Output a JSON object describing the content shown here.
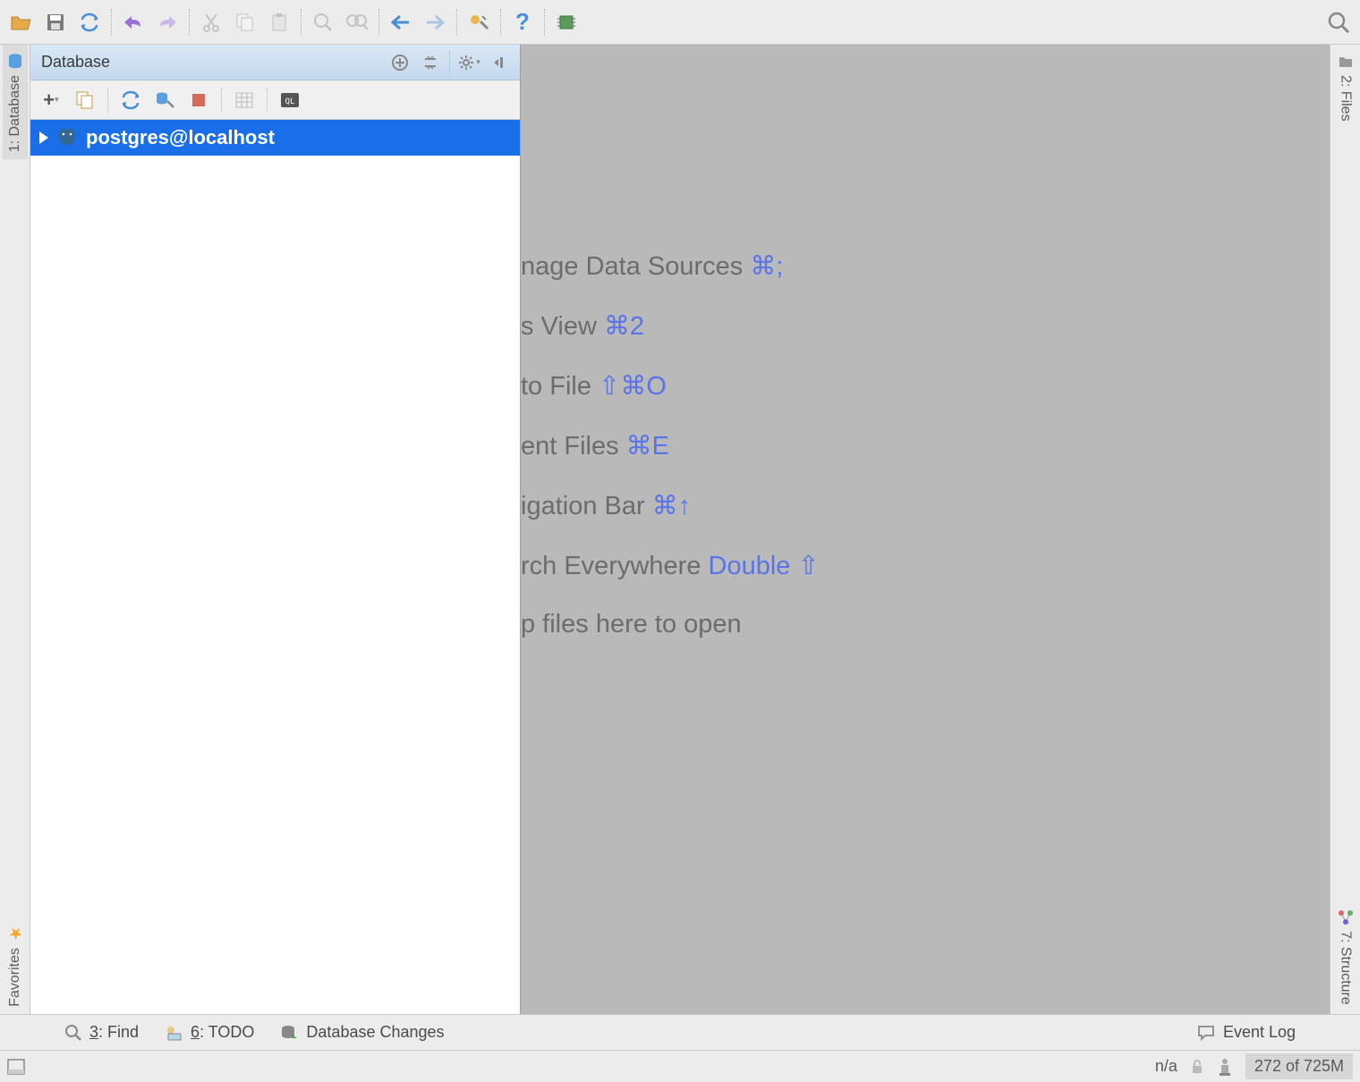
{
  "toolbar": {
    "icons": [
      "folder-open",
      "save",
      "sync",
      "sep",
      "undo",
      "redo",
      "sep",
      "cut",
      "copy",
      "paste",
      "sep",
      "zoom-out",
      "zoom-reset",
      "sep",
      "back",
      "forward",
      "sep",
      "tool",
      "sep",
      "help",
      "sep",
      "ic-chip"
    ]
  },
  "left_strip": {
    "database_tab": "1: Database",
    "favorites_tab": "Favorites"
  },
  "right_strip": {
    "files_tab": "2: Files",
    "structure_tab": "7: Structure"
  },
  "db_panel": {
    "title": "Database",
    "tree_item": "postgres@localhost"
  },
  "hints": {
    "l1_text": "nage Data Sources ",
    "l1_sc": "⌘;",
    "l2_text": "s View ",
    "l2_sc": "⌘2",
    "l3_text": "to File ",
    "l3_sc": "⇧⌘O",
    "l4_text": "ent Files ",
    "l4_sc": "⌘E",
    "l5_text": "igation Bar ",
    "l5_sc": "⌘↑",
    "l6_text": "rch Everywhere ",
    "l6_sc": "Double ⇧",
    "l7_text": "p files here to open"
  },
  "bottom_bar": {
    "find": "3: Find",
    "todo": "6: TODO",
    "db_changes": "Database Changes",
    "event_log": "Event Log"
  },
  "status": {
    "na": "n/a",
    "mem": "272 of 725M"
  }
}
